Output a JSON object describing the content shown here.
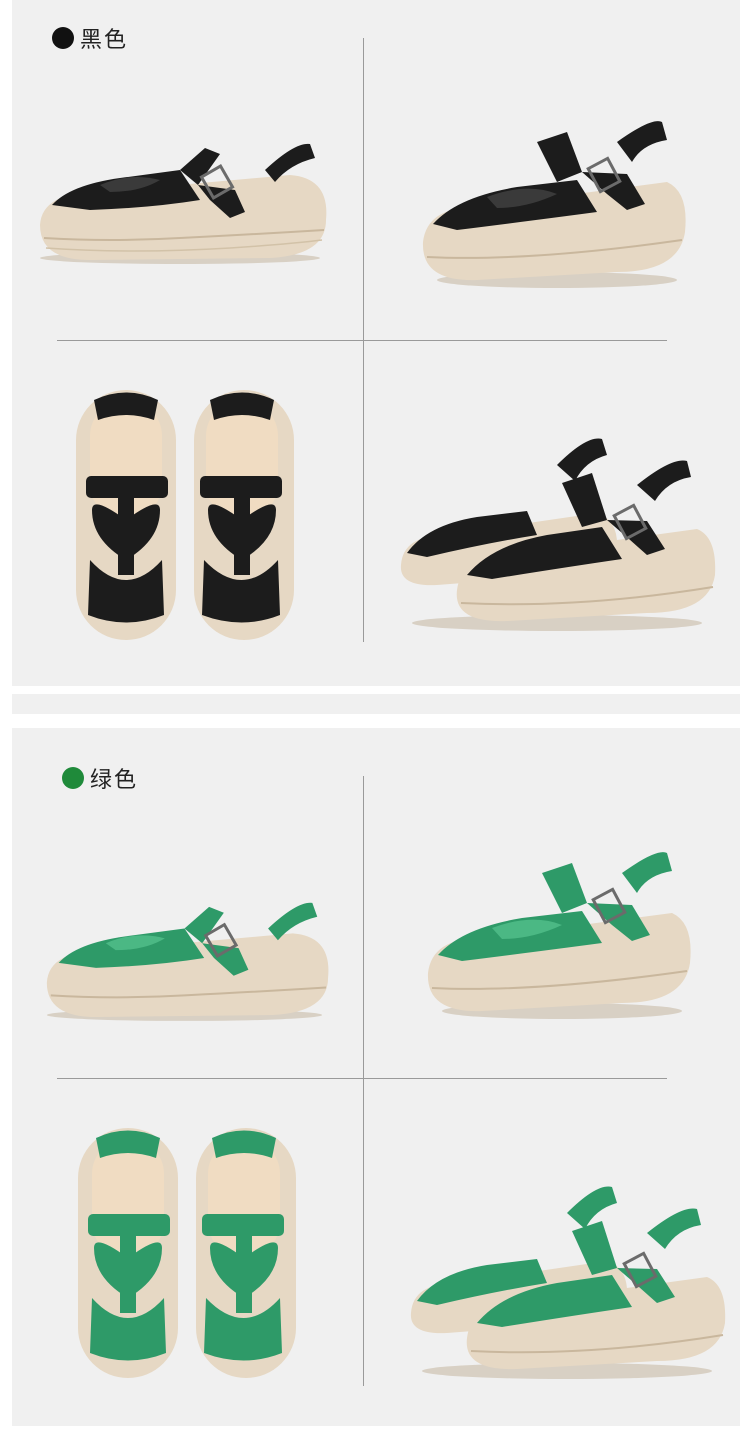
{
  "colors": {
    "panel_bg": "#f0f0f0",
    "sole": "#e6d8c4",
    "sole_shadow": "#c9b79d",
    "insole": "#f0dcc2",
    "black_leather": "#1c1c1c",
    "green_leather": "#2e9a68",
    "buckle": "#6b6b6b"
  },
  "variants": [
    {
      "id": "black",
      "label": "黑色",
      "dot_color": "#111111",
      "leather": "#1c1c1c",
      "leather_hi": "#3a3a3a"
    },
    {
      "id": "green",
      "label": "绿色",
      "dot_color": "#1f8a3a",
      "leather": "#2e9a68",
      "leather_hi": "#4bb884"
    }
  ]
}
